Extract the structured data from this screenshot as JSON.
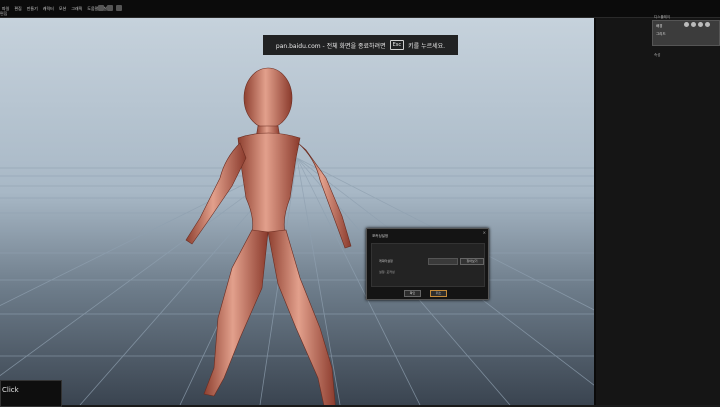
{
  "menubar": {
    "items": [
      "파일",
      "편집",
      "만들기",
      "캐릭터",
      "모션",
      "그래픽",
      "도움말",
      "설정",
      "창"
    ],
    "tab": "편집"
  },
  "notice": {
    "text_before": "pan.baidu.com - 전체 화면을 종료하려면",
    "key": "Esc",
    "text_after": "키를 누르세요."
  },
  "dialog": {
    "title": "포커싱설정",
    "label_primary": "캐릭터설정",
    "label_secondary": "설정: 포커싱",
    "side_button": "찾아보기",
    "ok": "확인",
    "cancel": "취소"
  },
  "hint": {
    "text": "Click"
  },
  "rightpanel": {
    "title": "디스플레이",
    "rows": [
      "배경",
      "그리드"
    ],
    "subtitle": "속성"
  }
}
